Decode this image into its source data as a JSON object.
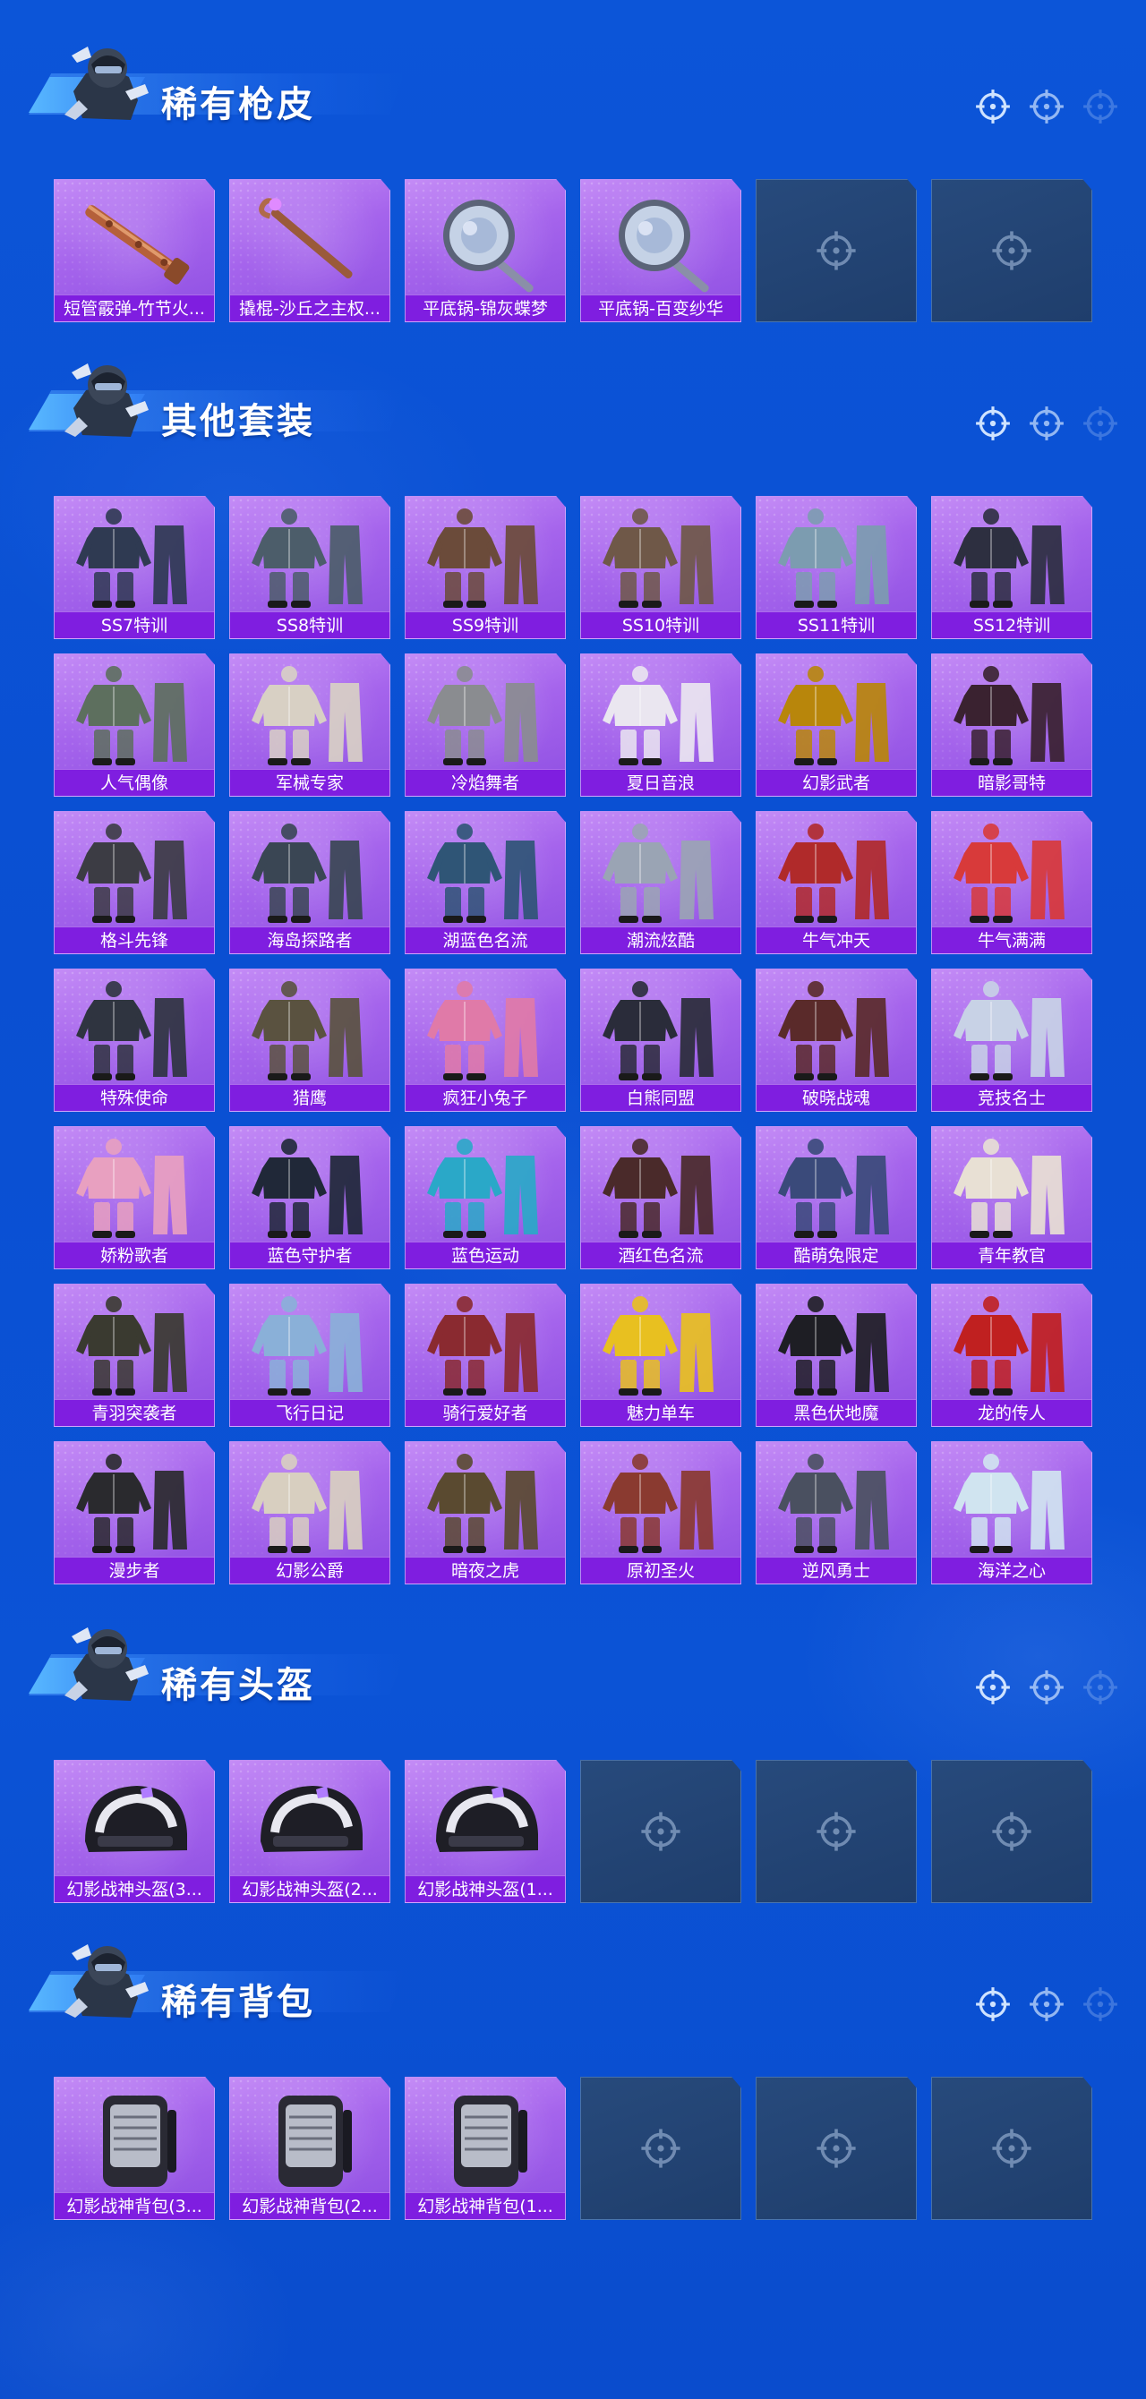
{
  "sections": [
    {
      "title": "稀有枪皮",
      "items": [
        {
          "label": "短管霰弹-竹节火...",
          "art": "shotgun"
        },
        {
          "label": "撬棍-沙丘之主权...",
          "art": "crowbar"
        },
        {
          "label": "平底锅-锦灰蝶梦",
          "art": "pan"
        },
        {
          "label": "平底锅-百变纱华",
          "art": "pan"
        }
      ],
      "empty_slots": 2
    },
    {
      "title": "其他套装",
      "items": [
        {
          "label": "SS7特训",
          "art": "outfit",
          "c": "#2f3a52"
        },
        {
          "label": "SS8特训",
          "art": "outfit",
          "c": "#4c5d6a"
        },
        {
          "label": "SS9特训",
          "art": "outfit",
          "c": "#6b4b3a"
        },
        {
          "label": "SS10特训",
          "art": "outfit",
          "c": "#6f5848"
        },
        {
          "label": "SS11特训",
          "art": "outfit",
          "c": "#7c9cb0"
        },
        {
          "label": "SS12特训",
          "art": "outfit",
          "c": "#2d2f40"
        },
        {
          "label": "人气偶像",
          "art": "outfit",
          "c": "#5d6f5e"
        },
        {
          "label": "军械专家",
          "art": "outfit",
          "c": "#d8d0c4"
        },
        {
          "label": "冷焰舞者",
          "art": "outfit",
          "c": "#8a8c90"
        },
        {
          "label": "夏日音浪",
          "art": "outfit",
          "c": "#eae6f0"
        },
        {
          "label": "幻影武者",
          "art": "outfit",
          "c": "#b8860b"
        },
        {
          "label": "暗影哥特",
          "art": "outfit",
          "c": "#3a2230"
        },
        {
          "label": "格斗先锋",
          "art": "outfit",
          "c": "#3c3c44"
        },
        {
          "label": "海岛探路者",
          "art": "outfit",
          "c": "#3a4654"
        },
        {
          "label": "湖蓝色名流",
          "art": "outfit",
          "c": "#2f5576"
        },
        {
          "label": "潮流炫酷",
          "art": "outfit",
          "c": "#9aa4b4"
        },
        {
          "label": "牛气冲天",
          "art": "outfit",
          "c": "#b02a2a"
        },
        {
          "label": "牛气满满",
          "art": "outfit",
          "c": "#d83a3a"
        },
        {
          "label": "特殊使命",
          "art": "outfit",
          "c": "#2f3440"
        },
        {
          "label": "猎鹰",
          "art": "outfit",
          "c": "#5a5240"
        },
        {
          "label": "疯狂小兔子",
          "art": "outfit",
          "c": "#e07aa8"
        },
        {
          "label": "白熊同盟",
          "art": "outfit",
          "c": "#2a2c3a"
        },
        {
          "label": "破晓战魂",
          "art": "outfit",
          "c": "#5a2a2a"
        },
        {
          "label": "竞技名士",
          "art": "outfit",
          "c": "#c8d2e6"
        },
        {
          "label": "娇粉歌者",
          "art": "outfit",
          "c": "#e8a0c0"
        },
        {
          "label": "蓝色守护者",
          "art": "outfit",
          "c": "#202838"
        },
        {
          "label": "蓝色运动",
          "art": "outfit",
          "c": "#2aa8c8"
        },
        {
          "label": "酒红色名流",
          "art": "outfit",
          "c": "#4a2a2a"
        },
        {
          "label": "酷萌兔限定",
          "art": "outfit",
          "c": "#3a4a7a"
        },
        {
          "label": "青年教官",
          "art": "outfit",
          "c": "#e8e0d4"
        },
        {
          "label": "青羽突袭者",
          "art": "outfit",
          "c": "#3a3a30"
        },
        {
          "label": "飞行日记",
          "art": "outfit",
          "c": "#8ab0d8"
        },
        {
          "label": "骑行爱好者",
          "art": "outfit",
          "c": "#8a2a30"
        },
        {
          "label": "魅力单车",
          "art": "outfit",
          "c": "#e8c020"
        },
        {
          "label": "黑色伏地魔",
          "art": "outfit",
          "c": "#1e1e24"
        },
        {
          "label": "龙的传人",
          "art": "outfit",
          "c": "#c02020"
        },
        {
          "label": "漫步者",
          "art": "outfit",
          "c": "#2a2a2e"
        },
        {
          "label": "幻影公爵",
          "art": "outfit",
          "c": "#d8cfc0"
        },
        {
          "label": "暗夜之虎",
          "art": "outfit",
          "c": "#5a4a30"
        },
        {
          "label": "原初圣火",
          "art": "outfit",
          "c": "#8a3a30"
        },
        {
          "label": "逆风勇士",
          "art": "outfit",
          "c": "#4a5060"
        },
        {
          "label": "海洋之心",
          "art": "outfit",
          "c": "#d0e4f0"
        }
      ],
      "empty_slots": 0
    },
    {
      "title": "稀有头盔",
      "items": [
        {
          "label": "幻影战神头盔(3...",
          "art": "helmet"
        },
        {
          "label": "幻影战神头盔(2...",
          "art": "helmet"
        },
        {
          "label": "幻影战神头盔(1...",
          "art": "helmet"
        }
      ],
      "empty_slots": 3
    },
    {
      "title": "稀有背包",
      "items": [
        {
          "label": "幻影战神背包(3...",
          "art": "backpack"
        },
        {
          "label": "幻影战神背包(2...",
          "art": "backpack"
        },
        {
          "label": "幻影战神背包(1...",
          "art": "backpack"
        }
      ],
      "empty_slots": 3
    }
  ]
}
